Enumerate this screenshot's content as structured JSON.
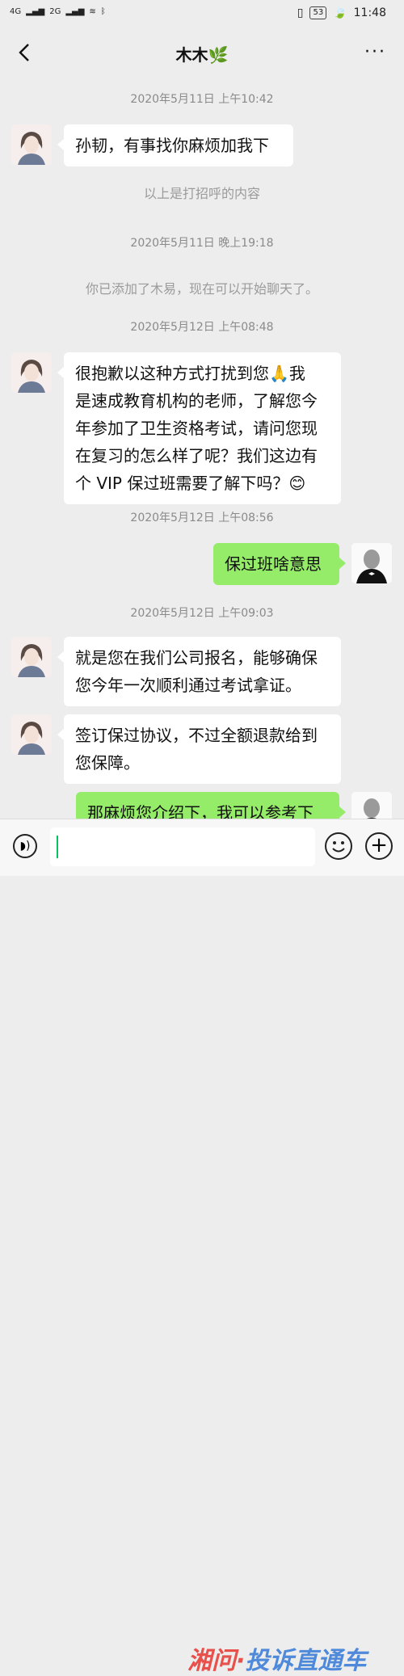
{
  "status_bar": {
    "signal_1": "4G",
    "signal_2": "2G",
    "battery": "53",
    "time": "11:48"
  },
  "header": {
    "title": "木木",
    "title_emoji": "leaf-emoji",
    "back_icon": "chevron-left-icon",
    "more_label": "···"
  },
  "messages": {
    "ts1": "2020年5月11日 上午10:42",
    "m1": "孙韧，有事找你麻烦加我下",
    "sys1": "以上是打招呼的内容",
    "ts2": "2020年5月11日 晚上19:18",
    "sys2": "你已添加了木易，现在可以开始聊天了。",
    "ts3": "2020年5月12日 上午08:48",
    "m2_l1": "很抱歉以这种方式打扰到您🙏我",
    "m2_l2": "是速成教育机构的老师，了解您今",
    "m2_l3": "年参加了卫生资格考试，请问您现",
    "m2_l4": "在复习的怎么样了呢？我们这边有",
    "m2_l5": "个 VIP 保过班需要了解下吗？😊",
    "ts4": "2020年5月12日 上午08:56",
    "m3": "保过班啥意思",
    "ts5": "2020年5月12日 上午09:03",
    "m4_l1": "就是您在我们公司报名，能够确保",
    "m4_l2": "您今年一次顺利通过考试拿证。",
    "m5_l1": "签订保过协议，不过全额退款给到",
    "m5_l2": "您保障。",
    "m6": "那麻烦您介绍下，我可以参考下"
  },
  "input_bar": {
    "value": "",
    "watermark_red": "湘问·",
    "watermark_blue": "投诉直通车"
  },
  "colors": {
    "accent_green": "#95ec69",
    "background": "#ededed",
    "cursor": "#07c160"
  }
}
